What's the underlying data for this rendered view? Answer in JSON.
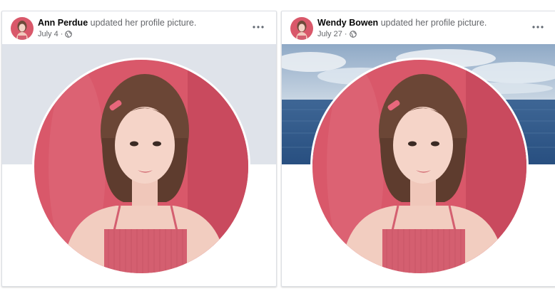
{
  "posts": [
    {
      "author": "Ann Perdue",
      "action": "updated her profile picture.",
      "date": "July 4",
      "separator": "·",
      "privacy_icon": "globe-icon",
      "cover": "plain-gray",
      "colors": {
        "cover": "#dfe3ea",
        "profile_bg": "#d9586a"
      }
    },
    {
      "author": "Wendy Bowen",
      "action": "updated her profile picture.",
      "date": "July 27",
      "separator": "·",
      "privacy_icon": "globe-icon",
      "cover": "sky-and-sea-photo",
      "colors": {
        "sky": "#9fb7cf",
        "sea": "#2f5a8c",
        "profile_bg": "#d9586a"
      }
    }
  ]
}
